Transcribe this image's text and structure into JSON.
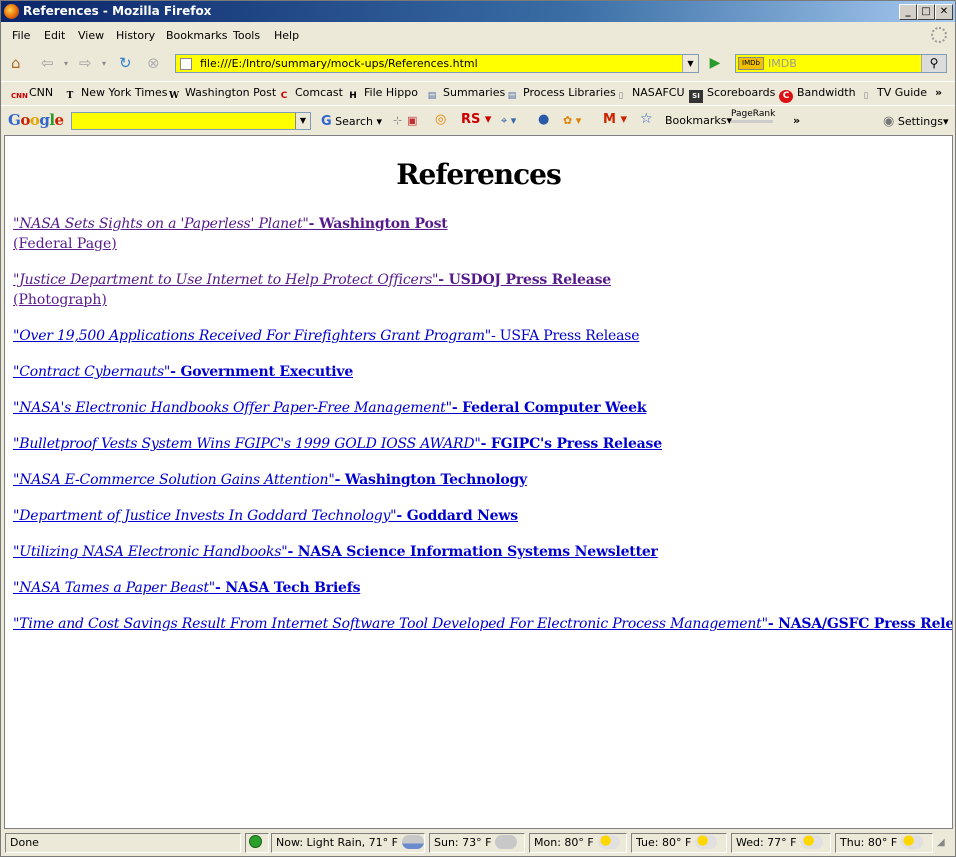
{
  "window": {
    "title": "References - Mozilla Firefox"
  },
  "menu": [
    {
      "label": "File",
      "key": "F"
    },
    {
      "label": "Edit",
      "key": "E"
    },
    {
      "label": "View",
      "key": "V"
    },
    {
      "label": "History",
      "key": "s"
    },
    {
      "label": "Bookmarks",
      "key": "B"
    },
    {
      "label": "Tools",
      "key": "T"
    },
    {
      "label": "Help",
      "key": "H"
    }
  ],
  "nav": {
    "url": "file:///E:/Intro/summary/mock-ups/References.html",
    "search_placeholder": "IMDB",
    "search_engine": "IMDb"
  },
  "bookmarks": [
    {
      "label": "CNN",
      "icon": "cnn-icon",
      "glyph": "CNN"
    },
    {
      "label": "New York Times",
      "icon": "nyt-icon",
      "glyph": "T"
    },
    {
      "label": "Washington Post",
      "icon": "washington-post-icon",
      "glyph": "W"
    },
    {
      "label": "Comcast",
      "icon": "comcast-icon",
      "glyph": "C"
    },
    {
      "label": "File Hippo",
      "icon": "file-hippo-icon",
      "glyph": "H"
    },
    {
      "label": "Summaries",
      "icon": "page-icon",
      "glyph": "▤"
    },
    {
      "label": "Process Libraries",
      "icon": "page-icon",
      "glyph": "▤"
    },
    {
      "label": "NASAFCU",
      "icon": "page-icon",
      "glyph": "▯"
    },
    {
      "label": "Scoreboards",
      "icon": "si-icon",
      "glyph": "SI"
    },
    {
      "label": "Bandwidth",
      "icon": "c-icon",
      "glyph": "C"
    },
    {
      "label": "TV Guide",
      "icon": "page-icon",
      "glyph": "▯"
    }
  ],
  "google_toolbar": {
    "logo": "Google",
    "search_label": "Search",
    "bookmarks_label": "Bookmarks",
    "pagerank_label": "PageRank",
    "settings_label": "Settings",
    "rs_label": "RS",
    "mail_label": "M"
  },
  "page": {
    "heading": "References",
    "references": [
      {
        "title": "\"NASA Sets Sights on a 'Paperless' Planet\"",
        "source": "- Washington Post",
        "visited": true,
        "sub": "(Federal Page)"
      },
      {
        "title": "\"Justice Department to Use Internet to Help Protect Officers\"",
        "source": "- USDOJ Press Release ",
        "visited": true,
        "sub": "(Photograph)"
      },
      {
        "title": "\"Over 19,500 Applications Received For Firefighters Grant Program\"",
        "source": "- USFA Press Release",
        "visited": false,
        "plain_source": true
      },
      {
        "title": "\"Contract Cybernauts\"",
        "source": "- Government Executive",
        "visited": false
      },
      {
        "title": "\"NASA's Electronic Handbooks Offer Paper-Free Management\"",
        "source": "- Federal Computer Week",
        "visited": false
      },
      {
        "title": "\"Bulletproof Vests System Wins FGIPC's 1999 GOLD IOSS AWARD\"",
        "source": "- FGIPC's Press Release",
        "visited": false
      },
      {
        "title": "\"NASA E-Commerce Solution Gains Attention\"",
        "source": "- Washington Technology",
        "visited": false
      },
      {
        "title": "\"Department of Justice Invests In Goddard Technology\"",
        "source": "- Goddard News",
        "visited": false
      },
      {
        "title": "\"Utilizing NASA Electronic Handbooks\"",
        "source": "- NASA Science Information Systems Newsletter",
        "visited": false
      },
      {
        "title": "\"NASA Tames a Paper Beast\"",
        "source": "- NASA Tech Briefs",
        "visited": false
      },
      {
        "title": "\"Time and Cost Savings Result From Internet Software Tool Developed For Electronic Process Management\"",
        "source": "- NASA/GSFC Press Release",
        "visited": false
      }
    ]
  },
  "status": {
    "text": "Done",
    "weather": [
      {
        "label": "Now: Light Rain, 71° F",
        "icon": "rain-cloud-icon"
      },
      {
        "label": "Sun: 73° F",
        "icon": "cloud-icon"
      },
      {
        "label": "Mon: 80° F",
        "icon": "partly-sunny-icon"
      },
      {
        "label": "Tue: 80° F",
        "icon": "partly-sunny-icon"
      },
      {
        "label": "Wed: 77° F",
        "icon": "partly-sunny-icon"
      },
      {
        "label": "Thu: 80° F",
        "icon": "partly-sunny-icon"
      }
    ]
  },
  "colors": {
    "link": "#0000cc",
    "visited": "#551a8b",
    "url_bg": "#ffff00",
    "title_bar": "#0a246a"
  }
}
